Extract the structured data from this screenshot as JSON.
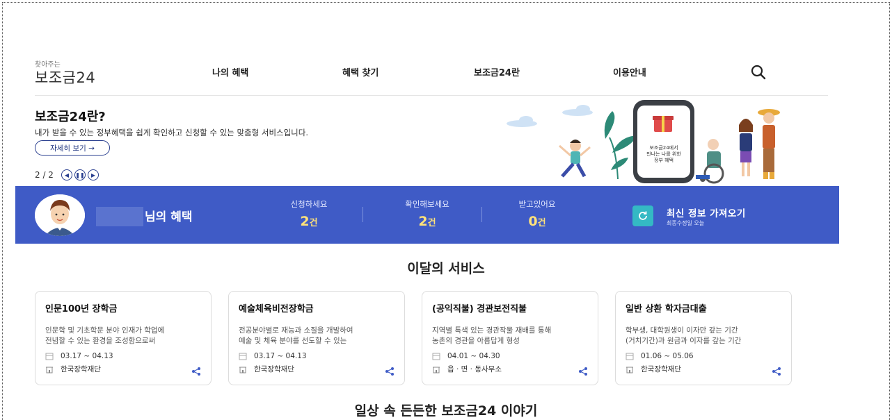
{
  "header": {
    "logo_small": "찾아주는",
    "logo_main": "보조금24",
    "nav": [
      "나의 혜택",
      "혜택 찾기",
      "보조금24란",
      "이용안내"
    ],
    "search_icon": "search-icon"
  },
  "hero": {
    "title": "보조금24란?",
    "desc": "내가 받을 수 있는 정부혜택을 쉽게 확인하고 신청할 수 있는 맞춤형 서비스입니다.",
    "detail_button": "자세히 보기 →",
    "pager": "2 / 2",
    "phone_text_1": "보조금24에서",
    "phone_text_2": "만나는 나를 위한",
    "phone_text_3": "정부 혜택"
  },
  "benefits_bar": {
    "label": "님의 혜택",
    "stats": [
      {
        "label": "신청하세요",
        "value": "2",
        "unit": "건"
      },
      {
        "label": "확인해보세요",
        "value": "2",
        "unit": "건"
      },
      {
        "label": "받고있어요",
        "value": "0",
        "unit": "건"
      }
    ],
    "refresh_title": "최신 정보 가져오기",
    "refresh_sub": "최종수정일 오늘",
    "accent_color": "#3f5bc6"
  },
  "monthly": {
    "title": "이달의 서비스",
    "cards": [
      {
        "title": "인문100년 장학금",
        "desc1": "인문학 및 기초학문 분야 인재가 학업에",
        "desc2": "전념할 수 있는 환경을 조성함으로써",
        "period": "03.17 ~ 04.13",
        "org": "한국장학재단"
      },
      {
        "title": "예술체육비전장학금",
        "desc1": "전공분야별로 재능과 소질을 개발하여",
        "desc2": "예술 및 체육 분야를 선도할 수 있는",
        "period": "03.17 ~ 04.13",
        "org": "한국장학재단"
      },
      {
        "title": "(공익직불) 경관보전직불",
        "desc1": "지역별 특색 있는 경관작물 재배를 통해",
        "desc2": "농촌의 경관을 아름답게 형성",
        "period": "04.01 ~ 04.30",
        "org": "읍 · 면 · 동사무소"
      },
      {
        "title": "일반 상환 학자금대출",
        "desc1": "학부생, 대학원생이 이자만 갚는 기간",
        "desc2": "(거치기간)과 원금과 이자를 갚는 기간",
        "period": "01.06 ~ 05.06",
        "org": "한국장학재단"
      }
    ]
  },
  "stories": {
    "title": "일상 속 든든한 보조금24 이야기"
  }
}
